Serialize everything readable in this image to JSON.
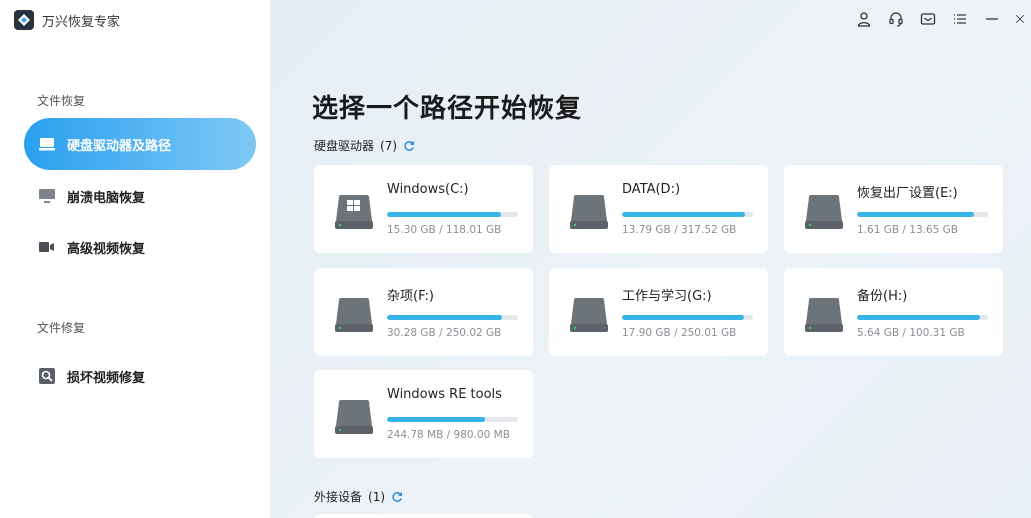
{
  "app": {
    "name": "万兴恢复专家"
  },
  "sidebar": {
    "sections": [
      {
        "label": "文件恢复"
      },
      {
        "label": "文件修复"
      }
    ],
    "items": [
      {
        "label": "硬盘驱动器及路径",
        "icon": "hard-drive-icon",
        "active": true
      },
      {
        "label": "崩溃电脑恢复",
        "icon": "monitor-icon",
        "active": false
      },
      {
        "label": "高级视频恢复",
        "icon": "video-camera-icon",
        "active": false
      },
      {
        "label": "损坏视频修复",
        "icon": "video-repair-icon",
        "active": false
      }
    ]
  },
  "titlebar": {
    "icons": [
      "user-icon",
      "headset-icon",
      "mail-icon",
      "menu-icon",
      "minimize-icon",
      "close-icon"
    ]
  },
  "main": {
    "title": "选择一个路径开始恢复",
    "hard_drives_header": "硬盘驱动器",
    "hard_drives_count": "(7)",
    "external_header": "外接设备",
    "external_count": "(1)",
    "drives": [
      {
        "name": "Windows(C:)",
        "size": "15.30 GB / 118.01 GB",
        "fill": 0.87,
        "system": true
      },
      {
        "name": "DATA(D:)",
        "size": "13.79 GB / 317.52 GB",
        "fill": 0.94,
        "system": false
      },
      {
        "name": "恢复出厂设置(E:)",
        "size": "1.61 GB / 13.65 GB",
        "fill": 0.89,
        "system": false
      },
      {
        "name": "杂项(F:)",
        "size": "30.28 GB / 250.02 GB",
        "fill": 0.88,
        "system": false
      },
      {
        "name": "工作与学习(G:)",
        "size": "17.90 GB / 250.01 GB",
        "fill": 0.93,
        "system": false
      },
      {
        "name": "备份(H:)",
        "size": "5.64 GB / 100.31 GB",
        "fill": 0.94,
        "system": false
      },
      {
        "name": "Windows RE tools",
        "size": "244.78 MB / 980.00 MB",
        "fill": 0.75,
        "system": false
      }
    ]
  },
  "colors": {
    "accent": "#2aa0f0",
    "bar": "#37b4e8",
    "drive": "#6d7479"
  }
}
